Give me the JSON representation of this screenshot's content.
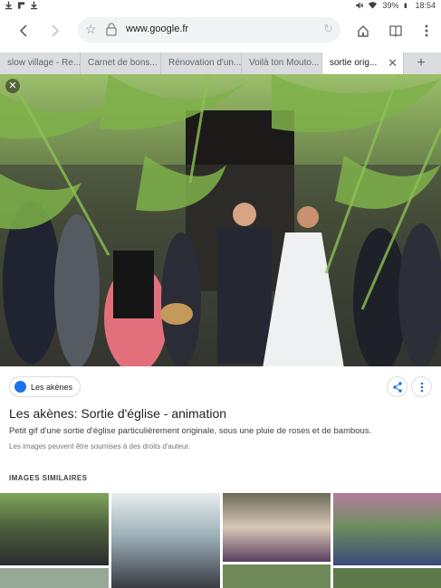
{
  "statusbar": {
    "battery": "39%",
    "time": "18:54",
    "icons": [
      "download-icon",
      "flipboard-icon",
      "download-icon",
      "mute-icon",
      "wifi-icon",
      "battery-icon"
    ]
  },
  "toolbar": {
    "url": "www.google.fr",
    "icons": [
      "back-icon",
      "forward-icon",
      "star-icon",
      "lock-icon",
      "reload-icon",
      "home-icon",
      "reader-icon",
      "overflow-menu-icon"
    ]
  },
  "tabs": [
    {
      "label": "slow village - Re..."
    },
    {
      "label": "Carnet de bons..."
    },
    {
      "label": "Rénovation d'un..."
    },
    {
      "label": "Voilà ton Mouto..."
    },
    {
      "label": "sortie orig...",
      "active": true
    }
  ],
  "tab_add": "+",
  "result": {
    "source": "Les akènes",
    "title": "Les akènes: Sortie d'église - animation",
    "description": "Petit gif d'une sortie d'église particulièrement originale, sous une pluie de roses et de bambous.",
    "rights": "Les images peuvent être soumises à des droits d'auteur.",
    "similar_heading": "IMAGES SIMILAIRES"
  },
  "colors": {
    "accent": "#1a73e8",
    "tab_strip": "#dadce0",
    "foliage": "#7fb24a"
  }
}
